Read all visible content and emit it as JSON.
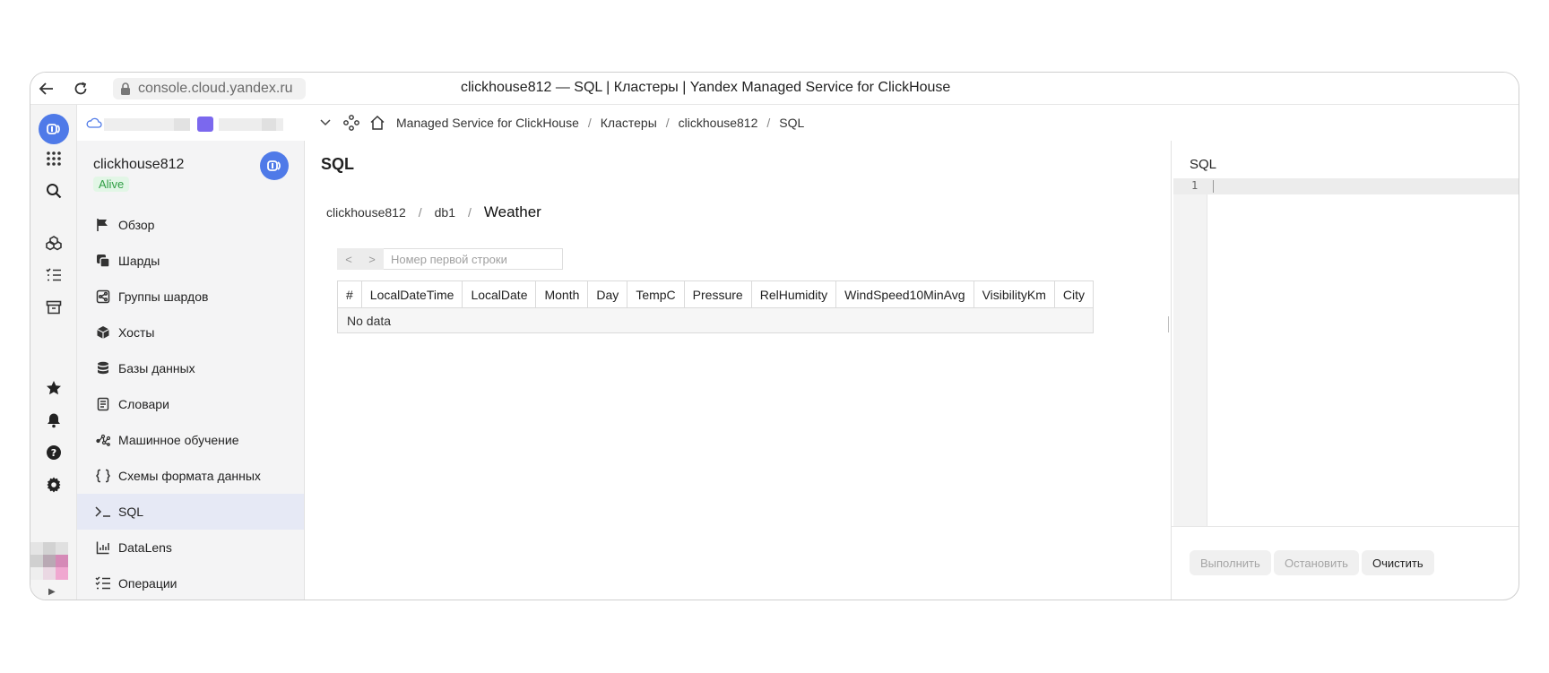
{
  "browser": {
    "url": "console.cloud.yandex.ru",
    "title": "clickhouse812 — SQL | Кластеры | Yandex Managed Service for ClickHouse"
  },
  "breadcrumbs": [
    "Managed Service for ClickHouse",
    "Кластеры",
    "clickhouse812",
    "SQL"
  ],
  "cluster": {
    "name": "clickhouse812",
    "status": "Alive"
  },
  "menu": [
    {
      "label": "Обзор",
      "icon": "flag-icon"
    },
    {
      "label": "Шарды",
      "icon": "shards-icon"
    },
    {
      "label": "Группы шардов",
      "icon": "share-icon"
    },
    {
      "label": "Хосты",
      "icon": "cube-icon"
    },
    {
      "label": "Базы данных",
      "icon": "database-icon"
    },
    {
      "label": "Словари",
      "icon": "book-icon"
    },
    {
      "label": "Машинное обучение",
      "icon": "ml-icon"
    },
    {
      "label": "Схемы формата данных",
      "icon": "braces-icon"
    },
    {
      "label": "SQL",
      "icon": "terminal-icon"
    },
    {
      "label": "DataLens",
      "icon": "chart-icon"
    },
    {
      "label": "Операции",
      "icon": "list-icon"
    }
  ],
  "main": {
    "heading": "SQL",
    "table_crumbs": {
      "cluster": "clickhouse812",
      "db": "db1",
      "table": "Weather"
    },
    "pager": {
      "prev": "<",
      "next": ">",
      "placeholder": "Номер первой строки"
    },
    "columns": [
      "#",
      "LocalDateTime",
      "LocalDate",
      "Month",
      "Day",
      "TempC",
      "Pressure",
      "RelHumidity",
      "WindSpeed10MinAvg",
      "VisibilityKm",
      "City"
    ],
    "empty_text": "No data"
  },
  "editor": {
    "title": "SQL",
    "line_number": "1",
    "run_label": "Выполнить",
    "stop_label": "Остановить",
    "clear_label": "Очистить"
  },
  "colors": {
    "accent": "#4f7ae8",
    "status_green": "#2f9e44",
    "active_item": "#e6e9f5"
  }
}
